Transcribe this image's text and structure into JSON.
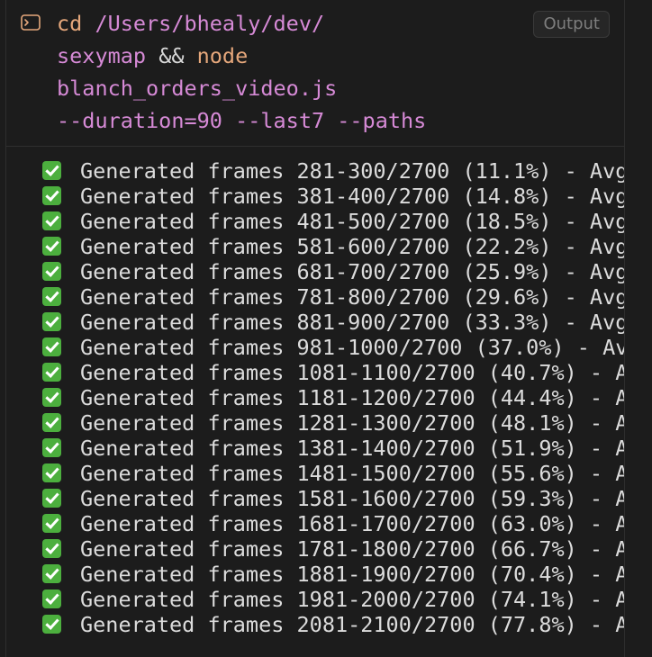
{
  "header": {
    "output_label": "Output",
    "command": {
      "line1": {
        "cmd": "cd",
        "arg": " /Users/bhealy/dev/"
      },
      "line2": {
        "arg": "sexymap",
        "op": " && ",
        "cmd": "node"
      },
      "line3": {
        "arg": "blanch_orders_video.js"
      },
      "line4": {
        "arg": "--duration=90 --last7 --paths"
      }
    }
  },
  "output": {
    "lines": [
      "Generated frames 281-300/2700 (11.1%) - Avg",
      "Generated frames 381-400/2700 (14.8%) - Avg",
      "Generated frames 481-500/2700 (18.5%) - Avg",
      "Generated frames 581-600/2700 (22.2%) - Avg",
      "Generated frames 681-700/2700 (25.9%) - Avg",
      "Generated frames 781-800/2700 (29.6%) - Avg",
      "Generated frames 881-900/2700 (33.3%) - Avg",
      "Generated frames 981-1000/2700 (37.0%) - Av",
      "Generated frames 1081-1100/2700 (40.7%) - A",
      "Generated frames 1181-1200/2700 (44.4%) - A",
      "Generated frames 1281-1300/2700 (48.1%) - A",
      "Generated frames 1381-1400/2700 (51.9%) - A",
      "Generated frames 1481-1500/2700 (55.6%) - A",
      "Generated frames 1581-1600/2700 (59.3%) - A",
      "Generated frames 1681-1700/2700 (63.0%) - A",
      "Generated frames 1781-1800/2700 (66.7%) - A",
      "Generated frames 1881-1900/2700 (70.4%) - A",
      "Generated frames 1981-2000/2700 (74.1%) - A",
      "Generated frames 2081-2100/2700 (77.8%) - A"
    ],
    "status_icon": "check-mark-icon"
  },
  "colors": {
    "background": "#1c1c1c",
    "command": "#e5a77b",
    "argument": "#d68ad6",
    "check": "#4caf3e"
  }
}
